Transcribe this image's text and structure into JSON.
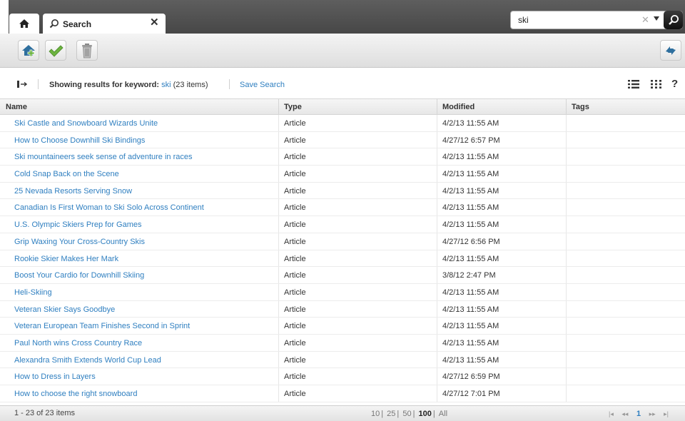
{
  "tabs": {
    "home_icon": "home-icon",
    "search_tab_label": "Search"
  },
  "search": {
    "value": "ski"
  },
  "toolbar": {
    "buttons": [
      "add-icon",
      "check-icon",
      "trash-icon"
    ],
    "right_button": "sync-icon"
  },
  "infobar": {
    "showing_label": "Showing results for keyword:",
    "keyword": "ski",
    "count": "(23 items)",
    "save_search": "Save Search"
  },
  "table": {
    "columns": [
      "Name",
      "Type",
      "Modified",
      "Tags"
    ],
    "rows": [
      {
        "name": "Ski Castle and Snowboard Wizards Unite",
        "type": "Article",
        "modified": "4/2/13 11:55 AM",
        "tags": ""
      },
      {
        "name": "How to Choose Downhill Ski Bindings",
        "type": "Article",
        "modified": "4/27/12 6:57 PM",
        "tags": ""
      },
      {
        "name": "Ski mountaineers seek sense of adventure in races",
        "type": "Article",
        "modified": "4/2/13 11:55 AM",
        "tags": ""
      },
      {
        "name": "Cold Snap Back on the Scene",
        "type": "Article",
        "modified": "4/2/13 11:55 AM",
        "tags": ""
      },
      {
        "name": "25 Nevada Resorts Serving Snow",
        "type": "Article",
        "modified": "4/2/13 11:55 AM",
        "tags": ""
      },
      {
        "name": "Canadian Is First Woman to Ski Solo Across Continent",
        "type": "Article",
        "modified": "4/2/13 11:55 AM",
        "tags": ""
      },
      {
        "name": "U.S. Olympic Skiers Prep for Games",
        "type": "Article",
        "modified": "4/2/13 11:55 AM",
        "tags": ""
      },
      {
        "name": "Grip Waxing Your Cross-Country Skis",
        "type": "Article",
        "modified": "4/27/12 6:56 PM",
        "tags": ""
      },
      {
        "name": "Rookie Skier Makes Her Mark",
        "type": "Article",
        "modified": "4/2/13 11:55 AM",
        "tags": ""
      },
      {
        "name": "Boost Your Cardio for Downhill Skiing",
        "type": "Article",
        "modified": "3/8/12 2:47 PM",
        "tags": ""
      },
      {
        "name": "Heli-Skiing",
        "type": "Article",
        "modified": "4/2/13 11:55 AM",
        "tags": ""
      },
      {
        "name": "Veteran Skier Says Goodbye",
        "type": "Article",
        "modified": "4/2/13 11:55 AM",
        "tags": ""
      },
      {
        "name": "Veteran European Team Finishes Second in Sprint",
        "type": "Article",
        "modified": "4/2/13 11:55 AM",
        "tags": ""
      },
      {
        "name": "Paul North wins Cross Country Race",
        "type": "Article",
        "modified": "4/2/13 11:55 AM",
        "tags": ""
      },
      {
        "name": "Alexandra Smith Extends World Cup Lead",
        "type": "Article",
        "modified": "4/2/13 11:55 AM",
        "tags": ""
      },
      {
        "name": "How to Dress in Layers",
        "type": "Article",
        "modified": "4/27/12 6:59 PM",
        "tags": ""
      },
      {
        "name": "How to choose the right snowboard",
        "type": "Article",
        "modified": "4/27/12 7:01 PM",
        "tags": ""
      }
    ]
  },
  "footer": {
    "range": "1 - 23 of 23 items",
    "page_sizes": [
      "10",
      "25",
      "50",
      "100",
      "All"
    ],
    "current_page_size": "100",
    "current_page": "1"
  },
  "colors": {
    "link": "#2f7fc0",
    "tabbar": "#4f4f4f",
    "add_icon": "#2e6f9e",
    "check_icon": "#6cb33f"
  }
}
